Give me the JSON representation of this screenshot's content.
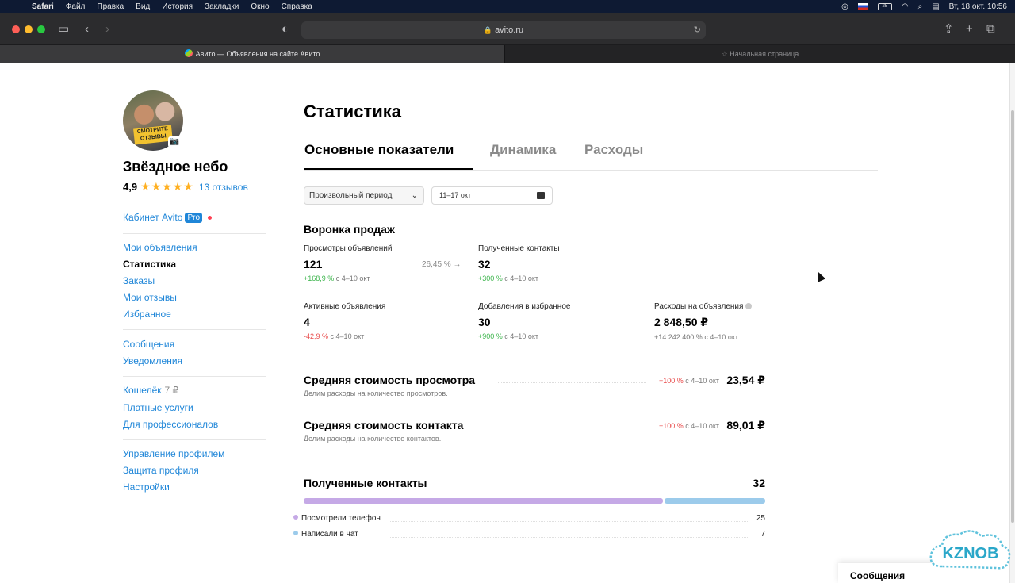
{
  "menubar": {
    "app": "Safari",
    "items": [
      "Файл",
      "Правка",
      "Вид",
      "История",
      "Закладки",
      "Окно",
      "Справка"
    ],
    "battery": "25",
    "datetime": "Вт, 18 окт.  10:56"
  },
  "browser": {
    "url": "avito.ru",
    "tabs": [
      {
        "title": "Авито — Объявления на сайте Авито"
      },
      {
        "title": "Начальная страница"
      }
    ]
  },
  "profile": {
    "avatar_caption": "СМОТРИТЕ ОТЗЫВЫ",
    "name": "Звёздное небо",
    "rating": "4,9",
    "stars": "★★★★★",
    "reviews": "13 отзывов",
    "cabinet_label": "Кабинет Avito",
    "pro_badge": "Pro"
  },
  "sidebar": {
    "group1": [
      "Мои объявления",
      "Статистика",
      "Заказы",
      "Мои отзывы",
      "Избранное"
    ],
    "group2": [
      "Сообщения",
      "Уведомления"
    ],
    "wallet_label": "Кошелёк",
    "wallet_amount": "7 ₽",
    "group3": [
      "Платные услуги",
      "Для профессионалов"
    ],
    "group4": [
      "Управление профилем",
      "Защита профиля",
      "Настройки"
    ]
  },
  "main": {
    "title": "Статистика",
    "tabs": [
      "Основные показатели",
      "Динамика",
      "Расходы"
    ],
    "period_select": "Произвольный период",
    "date_range": "11–17 окт",
    "funnel_title": "Воронка продаж",
    "conversion": "26,45 %",
    "metrics": [
      {
        "label": "Просмотры объявлений",
        "value": "121",
        "delta": "+168,9 %",
        "delta_kind": "pos",
        "period": "с 4–10 окт"
      },
      {
        "label": "Полученные контакты",
        "value": "32",
        "delta": "+300 %",
        "delta_kind": "pos",
        "period": "с 4–10 окт"
      },
      {
        "label": "Активные объявления",
        "value": "4",
        "delta": "-42,9 %",
        "delta_kind": "neg",
        "period": "с 4–10 окт"
      },
      {
        "label": "Добавления в избранное",
        "value": "30",
        "delta": "+900 %",
        "delta_kind": "pos",
        "period": "с 4–10 окт"
      },
      {
        "label": "Расходы на объявления",
        "value": "2 848,50 ₽",
        "delta": "+14 242 400 %",
        "delta_kind": "neu",
        "period": "с 4–10 окт"
      }
    ],
    "costs": [
      {
        "title": "Средняя стоимость просмотра",
        "desc": "Делим расходы на количество просмотров.",
        "delta": "+100 %",
        "period": "с 4–10 окт",
        "value": "23,54 ₽"
      },
      {
        "title": "Средняя стоимость контакта",
        "desc": "Делим расходы на количество контактов.",
        "delta": "+100 %",
        "period": "с 4–10 окт",
        "value": "89,01 ₽"
      }
    ],
    "contacts": {
      "title": "Полученные контакты",
      "total": "32",
      "breakdown": [
        {
          "label": "Посмотрели телефон",
          "count": 25,
          "color": "#c5a9e6"
        },
        {
          "label": "Написали в чат",
          "count": 7,
          "color": "#9ccbeb"
        }
      ]
    }
  },
  "messenger": {
    "label": "Сообщения"
  },
  "watermark": {
    "text": "KZNOB"
  },
  "colors": {
    "link": "#1f86d8",
    "positive": "#3bb44b",
    "negative": "#e84a4a",
    "star": "#ffb021"
  }
}
